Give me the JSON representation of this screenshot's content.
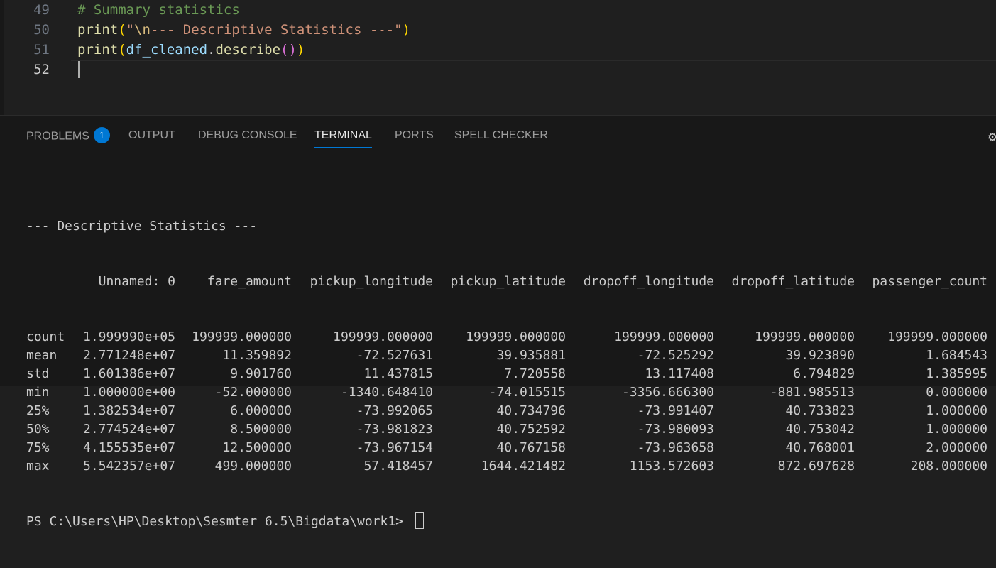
{
  "editor": {
    "lines": [
      {
        "number": "49",
        "tokens": [
          {
            "t": "# Summary statistics",
            "c": "tk-comment"
          }
        ]
      },
      {
        "number": "50",
        "tokens": [
          {
            "t": "print",
            "c": "tk-func"
          },
          {
            "t": "(",
            "c": "tk-paren1"
          },
          {
            "t": "\"",
            "c": "tk-string"
          },
          {
            "t": "\\n",
            "c": "tk-escape"
          },
          {
            "t": "--- Descriptive Statistics ---\"",
            "c": "tk-string"
          },
          {
            "t": ")",
            "c": "tk-paren1"
          }
        ]
      },
      {
        "number": "51",
        "tokens": [
          {
            "t": "print",
            "c": "tk-func"
          },
          {
            "t": "(",
            "c": "tk-paren1"
          },
          {
            "t": "df_cleaned",
            "c": "tk-var"
          },
          {
            "t": ".",
            "c": "tk-plain"
          },
          {
            "t": "describe",
            "c": "tk-func"
          },
          {
            "t": "()",
            "c": "tk-paren2"
          },
          {
            "t": ")",
            "c": "tk-paren1"
          }
        ]
      },
      {
        "number": "52",
        "tokens": []
      }
    ]
  },
  "panel": {
    "tabs": [
      {
        "label": "PROBLEMS",
        "badge": "1"
      },
      {
        "label": "OUTPUT"
      },
      {
        "label": "DEBUG CONSOLE"
      },
      {
        "label": "TERMINAL",
        "active": true
      },
      {
        "label": "PORTS"
      },
      {
        "label": "SPELL CHECKER"
      }
    ],
    "settings_icon": "gear-icon"
  },
  "terminal": {
    "heading": "--- Descriptive Statistics ---",
    "columns": [
      "",
      "Unnamed: 0",
      "fare_amount",
      "pickup_longitude",
      "pickup_latitude",
      "dropoff_longitude",
      "dropoff_latitude",
      "passenger_count"
    ],
    "rows": [
      [
        "count",
        "1.999990e+05",
        "199999.000000",
        "199999.000000",
        "199999.000000",
        "199999.000000",
        "199999.000000",
        "199999.000000"
      ],
      [
        "mean",
        "2.771248e+07",
        "11.359892",
        "-72.527631",
        "39.935881",
        "-72.525292",
        "39.923890",
        "1.684543"
      ],
      [
        "std",
        "1.601386e+07",
        "9.901760",
        "11.437815",
        "7.720558",
        "13.117408",
        "6.794829",
        "1.385995"
      ],
      [
        "min",
        "1.000000e+00",
        "-52.000000",
        "-1340.648410",
        "-74.015515",
        "-3356.666300",
        "-881.985513",
        "0.000000"
      ],
      [
        "25%",
        "1.382534e+07",
        "6.000000",
        "-73.992065",
        "40.734796",
        "-73.991407",
        "40.733823",
        "1.000000"
      ],
      [
        "50%",
        "2.774524e+07",
        "8.500000",
        "-73.981823",
        "40.752592",
        "-73.980093",
        "40.753042",
        "1.000000"
      ],
      [
        "75%",
        "4.155535e+07",
        "12.500000",
        "-73.967154",
        "40.767158",
        "-73.963658",
        "40.768001",
        "2.000000"
      ],
      [
        "max",
        "5.542357e+07",
        "499.000000",
        "57.418457",
        "1644.421482",
        "1153.572603",
        "872.697628",
        "208.000000"
      ]
    ],
    "prompt": "PS C:\\Users\\HP\\Desktop\\Sesmter 6.5\\Bigdata\\work1> "
  },
  "colors": {
    "accent": "#0078d4",
    "background": "#1f1f1f",
    "panel_background": "#181818"
  }
}
